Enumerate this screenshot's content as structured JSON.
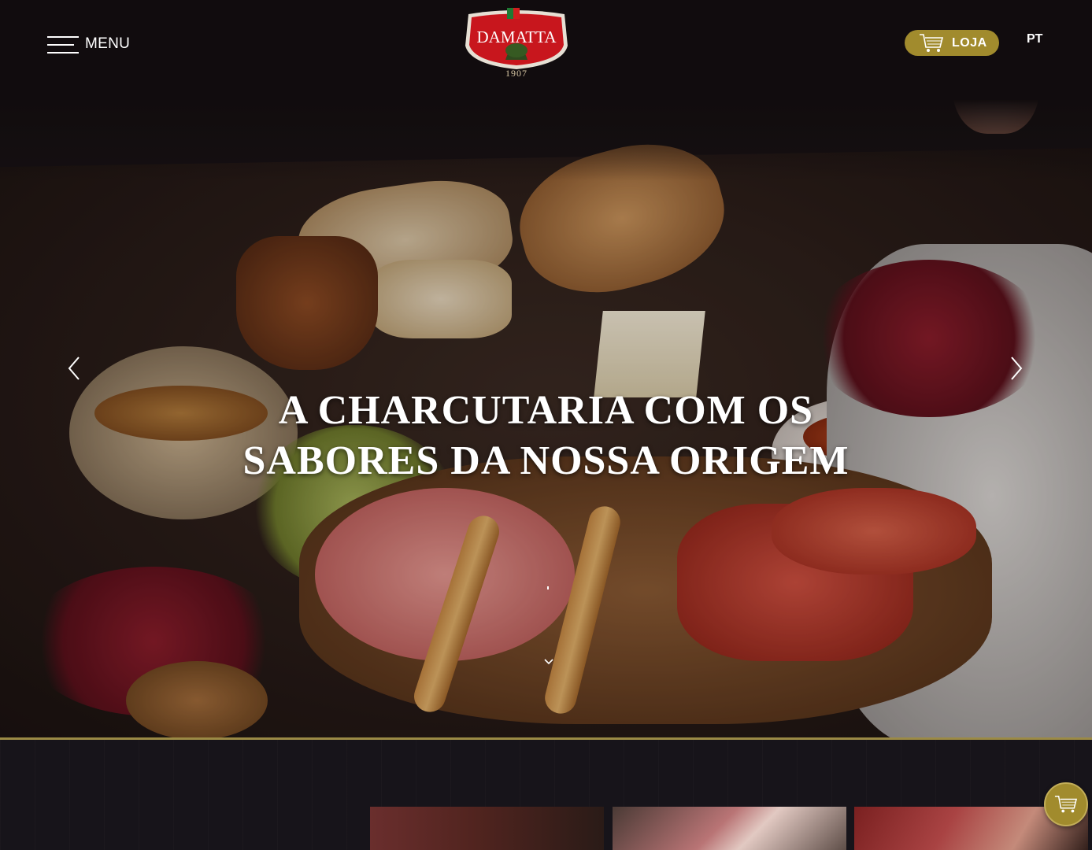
{
  "header": {
    "menu_label": "MENU",
    "logo_brand": "DAMATTA",
    "logo_year": "1907",
    "shop_label": "LOJA",
    "language": "PT"
  },
  "hero": {
    "headline_line1": "A charcutaria com os",
    "headline_line2": "sabores da nossa origem",
    "prev_icon": "chevron-left-icon",
    "next_icon": "chevron-right-icon",
    "scroll_icon": "chevron-down-icon"
  },
  "colors": {
    "accent_gold": "#a18b2d",
    "logo_red": "#c8161d",
    "background": "#131012"
  },
  "floating_cart": {
    "icon": "cart-icon"
  }
}
